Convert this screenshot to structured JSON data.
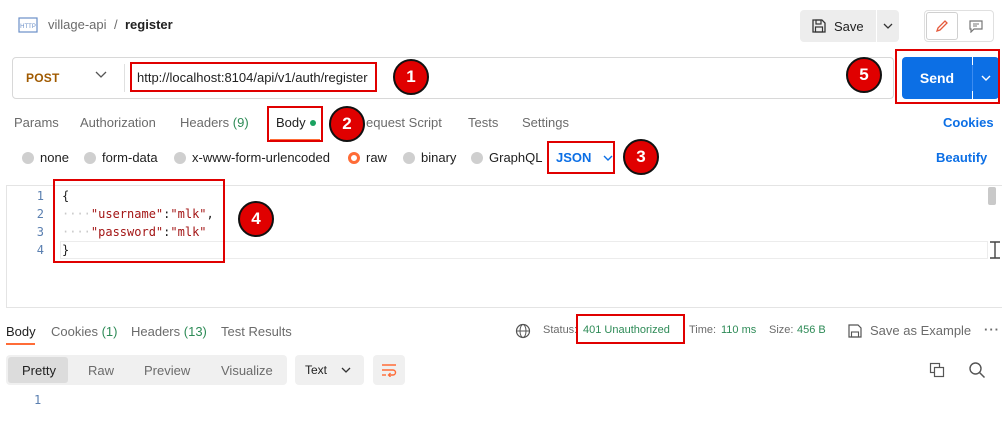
{
  "breadcrumb": {
    "collection": "village-api",
    "separator": "/",
    "request": "register"
  },
  "header": {
    "save_label": "Save"
  },
  "request": {
    "method": "POST",
    "url": "http://localhost:8104/api/v1/auth/register",
    "send_label": "Send"
  },
  "request_tabs": {
    "params": "Params",
    "authorization": "Authorization",
    "headers": "Headers",
    "headers_count": "(9)",
    "body": "Body",
    "pre_request": "equest Script",
    "tests": "Tests",
    "settings": "Settings",
    "cookies": "Cookies"
  },
  "body_types": {
    "none": "none",
    "form_data": "form-data",
    "urlencoded": "x-www-form-urlencoded",
    "raw": "raw",
    "binary": "binary",
    "graphql": "GraphQL",
    "format": "JSON",
    "beautify": "Beautify"
  },
  "editor": {
    "line_numbers": [
      "1",
      "2",
      "3",
      "4"
    ],
    "open_brace": "{",
    "username_key": "\"username\"",
    "username_val": "\"mlk\"",
    "password_key": "\"password\"",
    "password_val": "\"mlk\"",
    "close_brace": "}"
  },
  "response_tabs": {
    "body": "Body",
    "cookies": "Cookies",
    "cookies_count": "(1)",
    "headers": "Headers",
    "headers_count": "(13)",
    "test_results": "Test Results"
  },
  "response_meta": {
    "status_label": "Status:",
    "status_value": "401 Unauthorized",
    "time_label": "Time:",
    "time_value": "110 ms",
    "size_label": "Size:",
    "size_value": "456 B",
    "save_example": "Save as Example"
  },
  "response_view": {
    "pretty": "Pretty",
    "raw": "Raw",
    "preview": "Preview",
    "visualize": "Visualize",
    "format": "Text",
    "line1": "1"
  },
  "callouts": [
    "1",
    "2",
    "3",
    "4",
    "5"
  ],
  "colors": {
    "accent_orange": "#ff6c37",
    "send_blue": "#0c6fe5",
    "status_green": "#2e8b57",
    "callout_red": "#e00000"
  }
}
